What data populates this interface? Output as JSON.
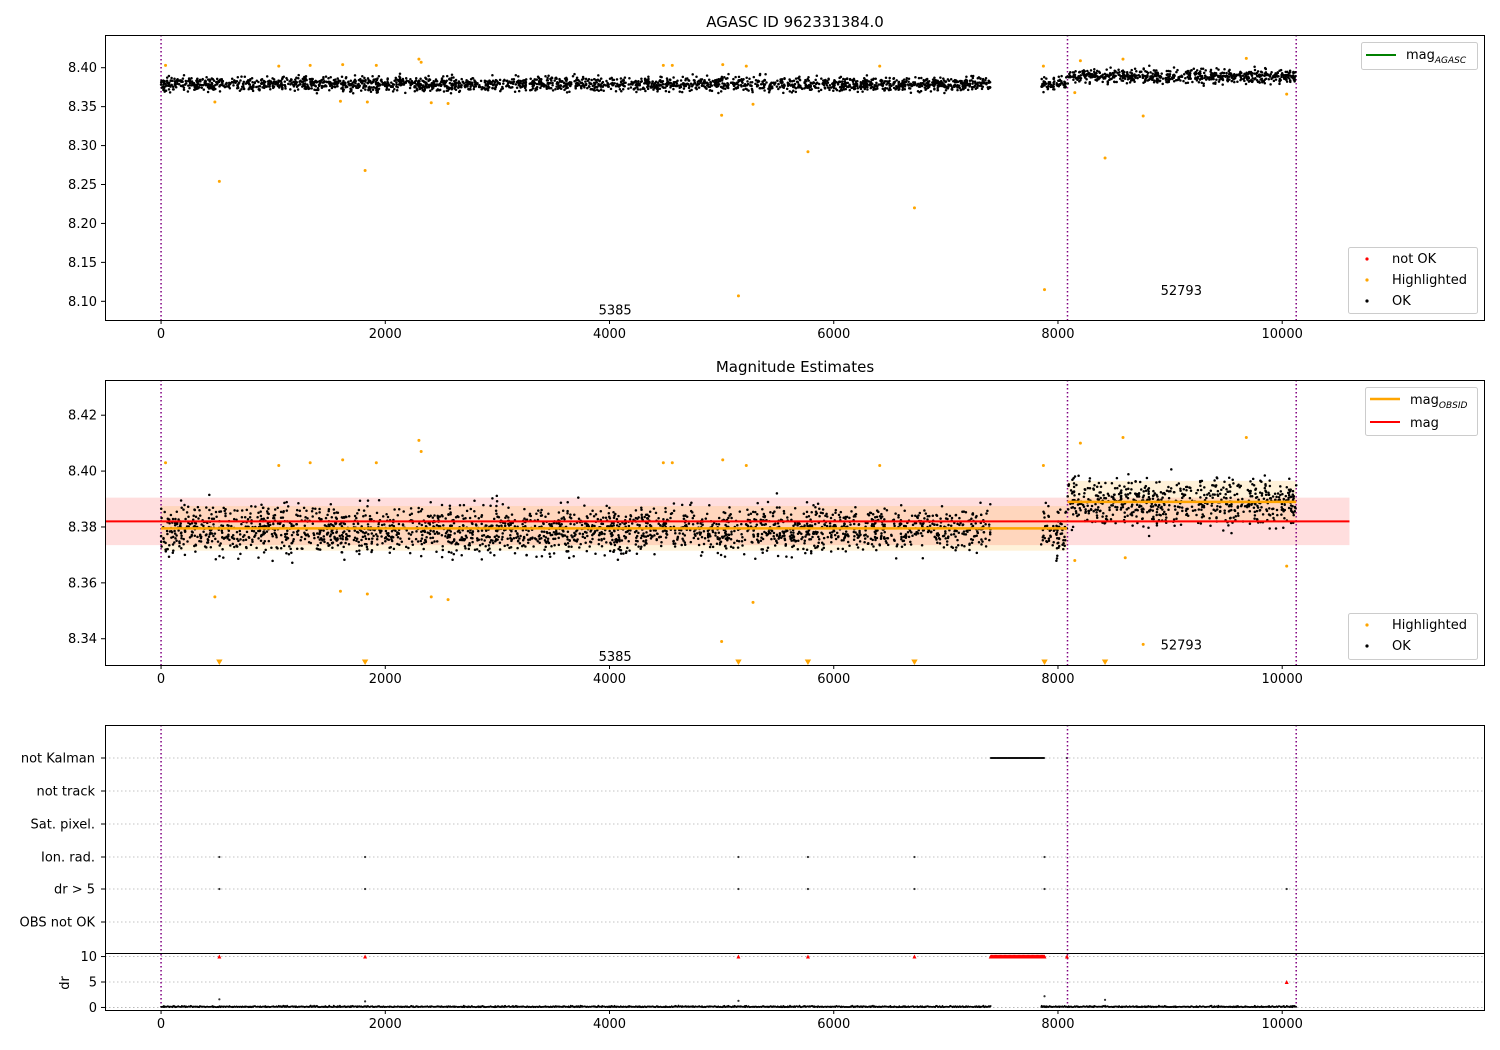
{
  "colors": {
    "ok": "#000000",
    "highlighted": "#ffa500",
    "not_ok": "#ff0000",
    "mag_agasc": "#008000",
    "mag_obsid": "#ffa500",
    "mag": "#ff0000",
    "obsid_boundary": "#800080",
    "grid": "#b0b0b0"
  },
  "chart_data": [
    {
      "type": "scatter",
      "title": "AGASC ID 962331384.0",
      "xlabel": "",
      "ylabel": "",
      "xlim": [
        -500,
        11800
      ],
      "ylim": [
        8.076,
        8.442
      ],
      "xticks": [
        0,
        2000,
        4000,
        6000,
        8000,
        10000
      ],
      "yticks": [
        8.1,
        8.15,
        8.2,
        8.25,
        8.3,
        8.35,
        8.4
      ],
      "obsid_boundaries": [
        0,
        8085,
        10125
      ],
      "obsid_labels": [
        {
          "text": "5385",
          "x": 4050,
          "y": 8.088
        },
        {
          "text": "52793",
          "x": 9100,
          "y": 8.113
        }
      ],
      "legend_upper": {
        "placement": "upper right",
        "entries": [
          {
            "label": "mag",
            "subscript": "AGASC",
            "color": "#008000"
          }
        ]
      },
      "legend_lower": {
        "placement": "lower right",
        "entries": [
          {
            "label": "not OK",
            "color": "#ff0000"
          },
          {
            "label": "Highlighted",
            "color": "#ffa500"
          },
          {
            "label": "OK",
            "color": "#000000"
          }
        ]
      },
      "series": [
        {
          "name": "OK",
          "description": "dense measurements",
          "segments": [
            {
              "x_range": [
                0,
                7400
              ],
              "mean": 8.379,
              "spread": 0.009
            },
            {
              "x_range": [
                7850,
                8080
              ],
              "mean": 8.379,
              "spread": 0.009
            },
            {
              "x_range": [
                8085,
                10125
              ],
              "mean": 8.389,
              "spread": 0.009
            }
          ]
        },
        {
          "name": "Highlighted",
          "points": [
            [
              520,
              8.254
            ],
            [
              1820,
              8.268
            ],
            [
              5150,
              8.107
            ],
            [
              5770,
              8.292
            ],
            [
              6720,
              8.22
            ],
            [
              7880,
              8.115
            ],
            [
              8420,
              8.284
            ],
            [
              8760,
              8.338
            ],
            [
              5000,
              8.339
            ],
            [
              40,
              8.403
            ],
            [
              480,
              8.356
            ],
            [
              1050,
              8.402
            ],
            [
              1330,
              8.403
            ],
            [
              1600,
              8.357
            ],
            [
              1620,
              8.404
            ],
            [
              1840,
              8.356
            ],
            [
              1920,
              8.403
            ],
            [
              2300,
              8.411
            ],
            [
              2320,
              8.407
            ],
            [
              2410,
              8.355
            ],
            [
              2560,
              8.354
            ],
            [
              4480,
              8.403
            ],
            [
              4560,
              8.403
            ],
            [
              5010,
              8.404
            ],
            [
              5220,
              8.402
            ],
            [
              5280,
              8.353
            ],
            [
              6410,
              8.402
            ],
            [
              7870,
              8.402
            ],
            [
              8150,
              8.368
            ],
            [
              8200,
              8.409
            ],
            [
              8580,
              8.411
            ],
            [
              9680,
              8.412
            ],
            [
              10040,
              8.366
            ]
          ]
        }
      ]
    },
    {
      "type": "scatter",
      "title": "Magnitude Estimates",
      "xlabel": "",
      "ylabel": "",
      "xlim": [
        -500,
        11800
      ],
      "ylim": [
        8.3306,
        8.4326
      ],
      "xticks": [
        0,
        2000,
        4000,
        6000,
        8000,
        10000
      ],
      "yticks": [
        8.34,
        8.36,
        8.38,
        8.4,
        8.42
      ],
      "obsid_boundaries": [
        0,
        8085,
        10125
      ],
      "obsid_labels": [
        {
          "text": "5385",
          "x": 4050,
          "y": 8.3335
        },
        {
          "text": "52793",
          "x": 9100,
          "y": 8.3375
        }
      ],
      "legend_upper": {
        "placement": "upper right",
        "entries": [
          {
            "label": "mag",
            "subscript": "OBSID",
            "color": "#ffa500"
          },
          {
            "label": "mag",
            "subscript": "",
            "color": "#ff0000"
          }
        ]
      },
      "legend_lower": {
        "placement": "lower right",
        "entries": [
          {
            "label": "Highlighted",
            "color": "#ffa500"
          },
          {
            "label": "OK",
            "color": "#000000"
          }
        ]
      },
      "mag": {
        "value": 8.382,
        "band": [
          8.3735,
          8.3905
        ],
        "x_range": [
          -500,
          10600
        ]
      },
      "mag_obsid": [
        {
          "x_range": [
            0,
            8080
          ],
          "value": 8.3795,
          "band": [
            8.3715,
            8.3875
          ]
        },
        {
          "x_range": [
            8085,
            10125
          ],
          "value": 8.389,
          "band": [
            8.3815,
            8.3965
          ]
        }
      ],
      "series": [
        {
          "name": "OK",
          "description": "dense measurements",
          "segments": [
            {
              "x_range": [
                0,
                7400
              ],
              "mean": 8.379,
              "spread": 0.0085
            },
            {
              "x_range": [
                7850,
                8080
              ],
              "mean": 8.379,
              "spread": 0.0085
            },
            {
              "x_range": [
                8085,
                10125
              ],
              "mean": 8.389,
              "spread": 0.0085
            }
          ]
        },
        {
          "name": "Highlighted",
          "points": [
            [
              40,
              8.403
            ],
            [
              480,
              8.355
            ],
            [
              1050,
              8.402
            ],
            [
              1330,
              8.403
            ],
            [
              1600,
              8.357
            ],
            [
              1620,
              8.404
            ],
            [
              1840,
              8.356
            ],
            [
              1920,
              8.403
            ],
            [
              2300,
              8.411
            ],
            [
              2320,
              8.407
            ],
            [
              2410,
              8.355
            ],
            [
              2560,
              8.354
            ],
            [
              4480,
              8.403
            ],
            [
              4560,
              8.403
            ],
            [
              5000,
              8.339
            ],
            [
              5010,
              8.404
            ],
            [
              5220,
              8.402
            ],
            [
              5280,
              8.353
            ],
            [
              6410,
              8.402
            ],
            [
              7870,
              8.402
            ],
            [
              8150,
              8.368
            ],
            [
              8200,
              8.41
            ],
            [
              8580,
              8.412
            ],
            [
              8600,
              8.369
            ],
            [
              8760,
              8.338
            ],
            [
              9680,
              8.412
            ],
            [
              10040,
              8.366
            ]
          ]
        },
        {
          "name": "Highlighted (below range)",
          "marker": "triangle-down",
          "points": [
            [
              520,
              8.3315
            ],
            [
              1820,
              8.3315
            ],
            [
              5150,
              8.3315
            ],
            [
              5770,
              8.3315
            ],
            [
              6720,
              8.3315
            ],
            [
              7880,
              8.3315
            ],
            [
              8420,
              8.3315
            ]
          ]
        }
      ]
    },
    {
      "type": "scatter",
      "title": "",
      "xlabel": "",
      "ylabel": "",
      "xlim": [
        -500,
        11800
      ],
      "categories": [
        "not Kalman",
        "not track",
        "Sat. pixel.",
        "Ion. rad.",
        "dr > 5",
        "OBS not OK"
      ],
      "obsid_boundaries": [
        0,
        8085,
        10125
      ],
      "flags": {
        "not Kalman": {
          "x_range": [
            7400,
            7880
          ],
          "extra_x": [
            8080
          ]
        },
        "not track": {
          "x_range": null,
          "extra_x": []
        },
        "Sat. pixel.": {
          "x_range": null,
          "extra_x": []
        },
        "Ion. rad.": {
          "x_range": null,
          "extra_x": [
            520,
            1820,
            5150,
            5770,
            6720,
            7880
          ]
        },
        "dr > 5": {
          "x_range": null,
          "extra_x": [
            520,
            1820,
            5150,
            5770,
            6720,
            7880,
            10040
          ]
        },
        "OBS not OK": {
          "x_range": null,
          "extra_x": []
        }
      }
    },
    {
      "type": "scatter",
      "title": "",
      "xlabel": "",
      "ylabel": "dr",
      "xlim": [
        -500,
        11800
      ],
      "ylim": [
        -0.5,
        10.5
      ],
      "yticks": [
        0,
        5,
        10
      ],
      "obsid_boundaries": [
        0,
        8085,
        10125
      ],
      "series": [
        {
          "name": "dr",
          "color": "#000000",
          "description": "near zero, segments",
          "segments": [
            [
              0,
              7400
            ],
            [
              7850,
              8080
            ],
            [
              8085,
              10125
            ]
          ],
          "outliers": [
            [
              520,
              1.6
            ],
            [
              1820,
              1.2
            ],
            [
              5150,
              1.3
            ],
            [
              7880,
              2.2
            ],
            [
              8420,
              1.5
            ]
          ]
        },
        {
          "name": "dr clipped",
          "color": "#ff0000",
          "points": [
            [
              520,
              10
            ],
            [
              1820,
              10
            ],
            [
              5150,
              10
            ],
            [
              5770,
              10
            ],
            [
              6720,
              10
            ],
            [
              8080,
              10
            ],
            [
              10040,
              5
            ]
          ],
          "range": [
            7400,
            7880
          ]
        }
      ]
    }
  ]
}
